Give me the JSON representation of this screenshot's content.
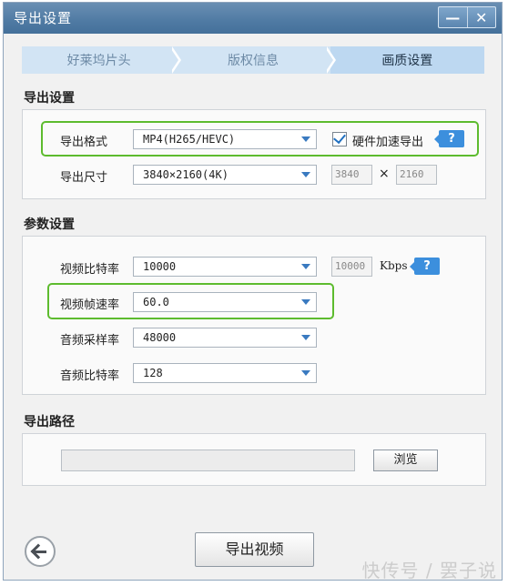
{
  "window": {
    "title": "导出设置",
    "minimize_glyph": "—",
    "close_glyph": "✕"
  },
  "steps": [
    "好莱坞片头",
    "版权信息",
    "画质设置"
  ],
  "export_settings": {
    "section_title": "导出设置",
    "format_label": "导出格式",
    "format_value": "MP4(H265/HEVC)",
    "hw_accel_label": "硬件加速导出",
    "hw_accel_checked": true,
    "size_label": "导出尺寸",
    "size_value": "3840×2160(4K)",
    "width": "3840",
    "times": "×",
    "height": "2160"
  },
  "param_settings": {
    "section_title": "参数设置",
    "video_bitrate_label": "视频比特率",
    "video_bitrate_value": "10000",
    "video_bitrate_field": "10000",
    "bitrate_unit": "Kbps",
    "frame_rate_label": "视频帧速率",
    "frame_rate_value": "60.0",
    "audio_sample_label": "音频采样率",
    "audio_sample_value": "48000",
    "audio_bitrate_label": "音频比特率",
    "audio_bitrate_value": "128"
  },
  "export_path": {
    "section_title": "导出路径",
    "path_value": "",
    "browse_label": "浏览"
  },
  "actions": {
    "export_video_label": "导出视频"
  },
  "help_glyph": "?",
  "watermark": "快传号 / 罢子说",
  "colors": {
    "titlebar": "#5a84ad",
    "highlight": "#5dbb2e",
    "help": "#3c8fdd",
    "active_step": "#bdd8f1"
  }
}
